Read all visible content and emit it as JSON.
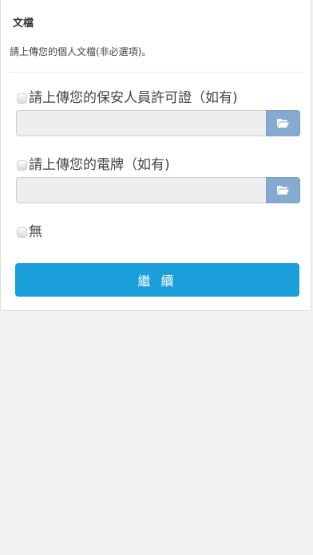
{
  "section": {
    "title": "文檔",
    "subtitle": "請上傳您的個人文檔(非必選項)。"
  },
  "options": [
    {
      "label": "請上傳您的保安人員許可證（如有)",
      "has_upload": true,
      "checked": false
    },
    {
      "label": "請上傳您的電牌（如有)",
      "has_upload": true,
      "checked": false
    },
    {
      "label": "無",
      "has_upload": false,
      "checked": false
    }
  ],
  "upload": {
    "input_value": "",
    "button_icon": "folder-open-icon"
  },
  "continue_button": {
    "label": "繼 續"
  },
  "colors": {
    "accent": "#1b9fdb",
    "upload_button": "#85a9cf",
    "page_background": "#f2f2f2"
  }
}
